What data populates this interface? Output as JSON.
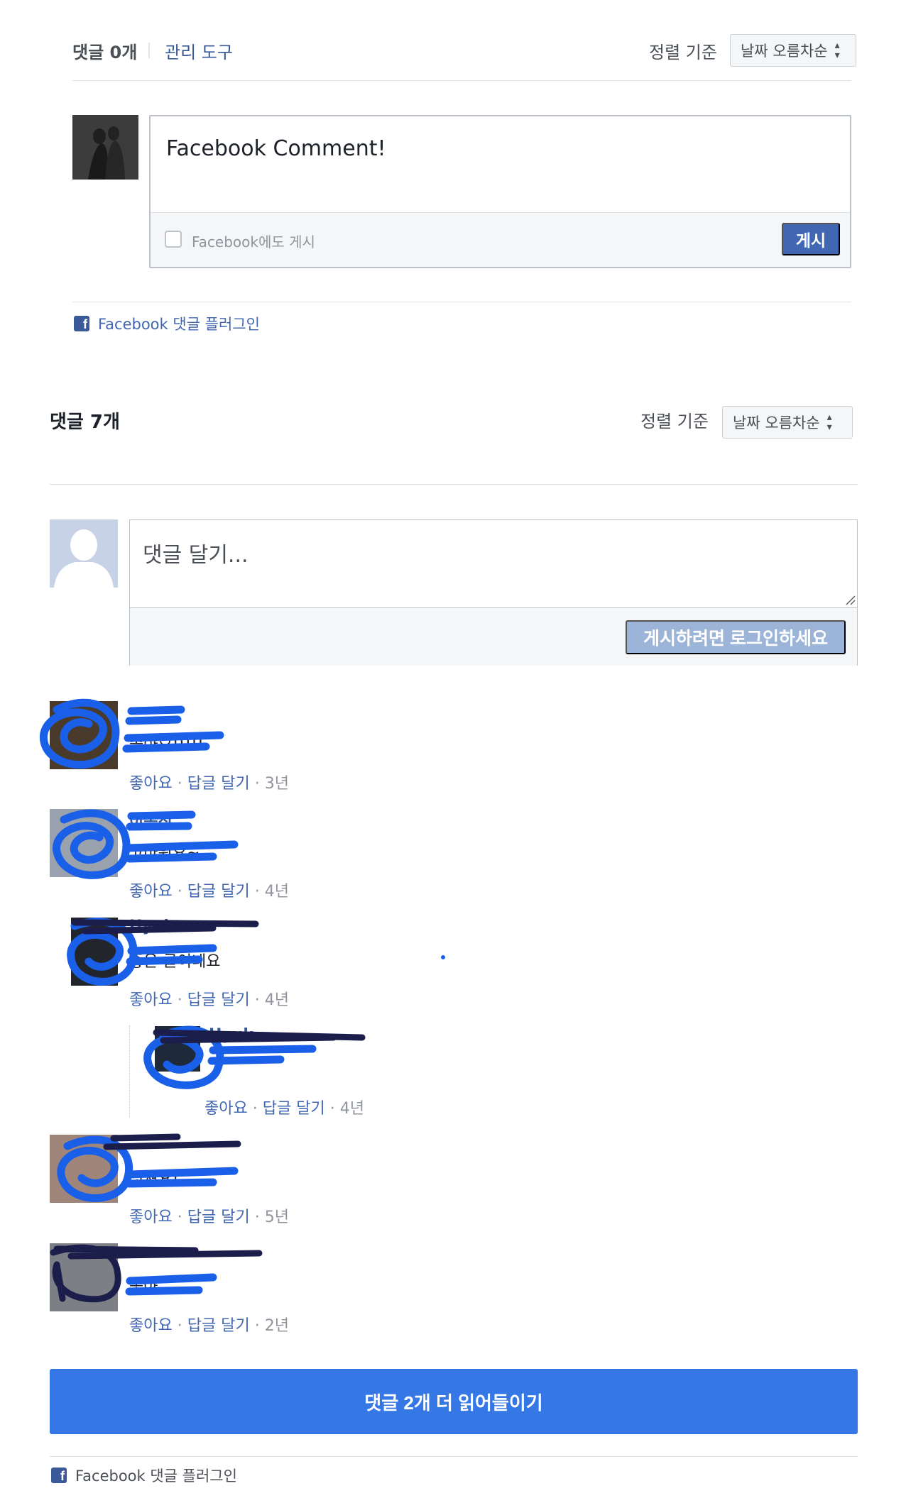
{
  "top_plugin": {
    "count_label": "댓글 0개",
    "moderation_label": "관리 도구",
    "sort_label": "정렬 기준",
    "sort_value": "날짜 오름차순",
    "comment_text": "Facebook Comment!",
    "post_to_fb_label": "Facebook에도 게시",
    "post_button": "게시",
    "plugin_link": "Facebook 댓글 플러그인"
  },
  "main_plugin": {
    "count_label": "댓글 7개",
    "sort_label": "정렬 기준",
    "sort_value": "날짜 오름차순",
    "comment_placeholder": "댓글 달기...",
    "login_button": "게시하려면 로그인하세요",
    "actions": {
      "like": "좋아요",
      "reply": "답글 달기",
      "sep": "·"
    },
    "comments": [
      {
        "name": "",
        "body": "좋아요!!!!!",
        "age": "3년"
      },
      {
        "name": "이동진",
        "body": "고마워요~",
        "age": "4년"
      },
      {
        "name": "Hyuk",
        "body": "좋은 글이네요",
        "age": "4년"
      },
      {
        "name": "Hyuk",
        "body": "",
        "age": "4년"
      },
      {
        "name": "",
        "body": "멋져요!",
        "age": "5년"
      },
      {
        "name": "",
        "body": "좋아",
        "age": "2년"
      }
    ],
    "load_more": "댓글 2개 더 읽어들이기",
    "plugin_link": "Facebook 댓글 플러그인"
  },
  "colors": {
    "fb_blue": "#4267b2",
    "link_blue": "#365899",
    "load_more_blue": "#3578e5",
    "redaction_blue": "#1a5fe8",
    "redaction_navy": "#1b1d4a"
  },
  "icons": [
    "facebook-icon",
    "chevron-updown-icon",
    "default-avatar-icon",
    "resize-handle-icon"
  ]
}
